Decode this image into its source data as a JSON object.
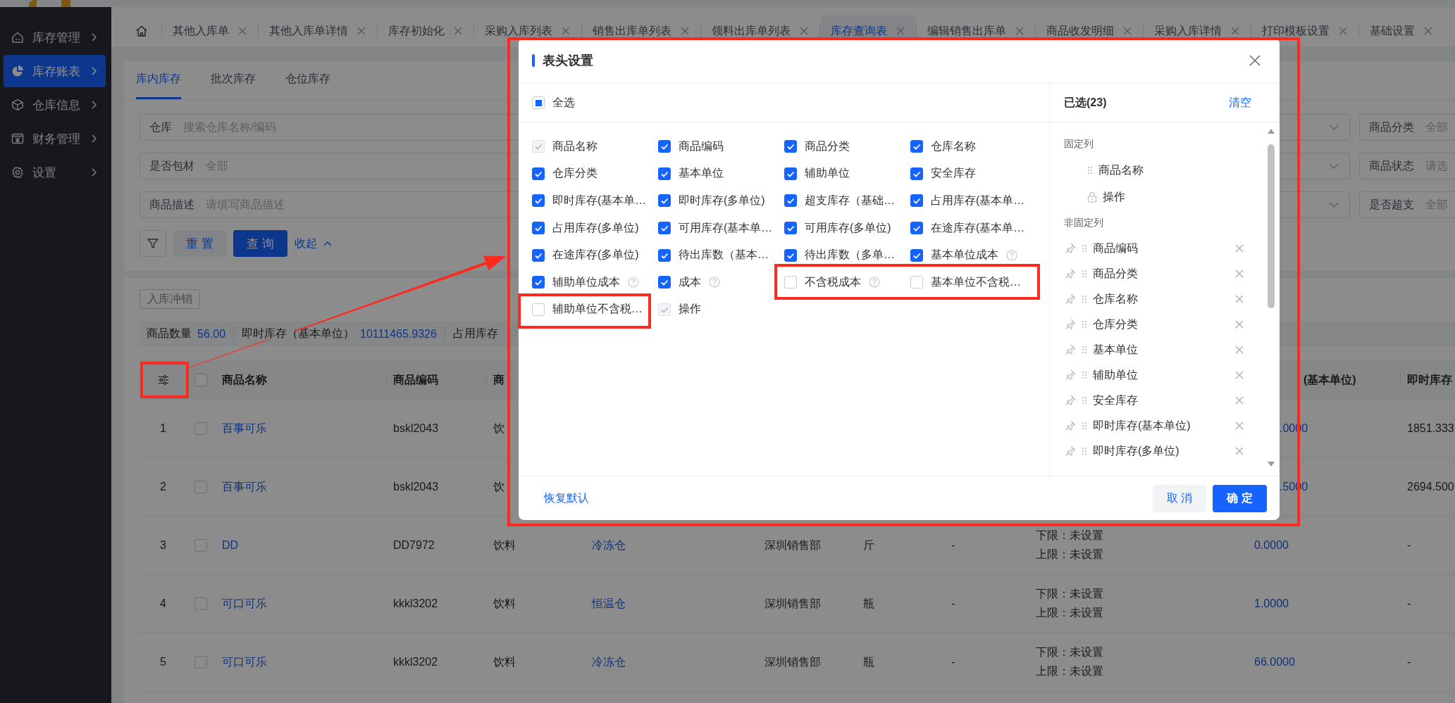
{
  "sidebar": {
    "items": [
      {
        "label": "库存管理",
        "selected": false
      },
      {
        "label": "库存账表",
        "selected": true
      },
      {
        "label": "仓库信息",
        "selected": false
      },
      {
        "label": "财务管理",
        "selected": false
      },
      {
        "label": "设置",
        "selected": false
      }
    ]
  },
  "tabs": [
    {
      "kind": "home",
      "selected": false
    },
    {
      "kind": "page",
      "label": "其他入库单",
      "selected": false
    },
    {
      "kind": "page",
      "label": "其他入库单详情",
      "selected": false
    },
    {
      "kind": "page",
      "label": "库存初始化",
      "selected": false
    },
    {
      "kind": "page",
      "label": "采购入库列表",
      "selected": false
    },
    {
      "kind": "page",
      "label": "销售出库单列表",
      "selected": false
    },
    {
      "kind": "page",
      "label": "领料出库单列表",
      "selected": false
    },
    {
      "kind": "page",
      "label": "库存查询表",
      "selected": true
    },
    {
      "kind": "page",
      "label": "编辑销售出库单",
      "selected": false
    },
    {
      "kind": "page",
      "label": "商品收发明细",
      "selected": false
    },
    {
      "kind": "page",
      "label": "采购入库详情",
      "selected": false
    },
    {
      "kind": "page",
      "label": "打印模板设置",
      "selected": false
    },
    {
      "kind": "page",
      "label": "基础设置",
      "selected": false
    }
  ],
  "sub_tabs": [
    {
      "label": "库内库存",
      "selected": true
    },
    {
      "label": "批次库存",
      "selected": false
    },
    {
      "label": "仓位库存",
      "selected": false
    }
  ],
  "filters": [
    {
      "label": "仓库",
      "placeholder": "搜索仓库名称/编码"
    },
    {
      "label": "商品分类",
      "placeholder": "全部"
    },
    {
      "label": "是否包材",
      "placeholder": "全部"
    },
    {
      "label": "商品状态",
      "placeholder": "请选"
    },
    {
      "label": "商品描述",
      "placeholder": "请填写商品描述"
    },
    {
      "label": "是否超支",
      "placeholder": "全部"
    }
  ],
  "filter_actions": {
    "reset": "重 置",
    "search": "查 询",
    "collapse": "收起"
  },
  "toolbar": [
    {
      "label": "入库冲销",
      "disabled": true
    }
  ],
  "summary": [
    {
      "label": "商品数量",
      "value": "56.00"
    },
    {
      "label": "即时库存（基本单位）",
      "value": "10111465.9326"
    },
    {
      "label": "占用库存"
    }
  ],
  "table": {
    "header_checkbox": {
      "checked": false
    },
    "columns": {
      "name": "商品名称",
      "code": "商品编码",
      "column_5": "商",
      "column_11": "(基本单位)",
      "column_12": "即时库存"
    },
    "rows": [
      {
        "index": "1",
        "selected": false,
        "name": "百事可乐",
        "code": "bskl2043",
        "column_5": "饮",
        "column_11": ".0000",
        "column_12": "1851.333"
      },
      {
        "index": "2",
        "selected": false,
        "name": "百事可乐",
        "code": "bskl2043",
        "column_5": "饮",
        "column_11": ".5000",
        "column_12": "2694.500"
      },
      {
        "index": "3",
        "selected": false,
        "name": "DD",
        "code": "DD7972",
        "column_5": "饮料",
        "column_6": "冷冻仓",
        "column_7": "深圳销售部",
        "column_8": "斤",
        "column_9": "-",
        "column_10": [
          "下限：未设置",
          "上限：未设置"
        ],
        "column_11": "0.0000",
        "column_12": "-"
      },
      {
        "index": "4",
        "selected": false,
        "name": "可口可乐",
        "code": "kkkl3202",
        "column_5": "饮料",
        "column_6": "恒温仓",
        "column_7": "深圳销售部",
        "column_8": "瓶",
        "column_9": "-",
        "column_10": [
          "下限：未设置",
          "上限：未设置"
        ],
        "column_11": "1.0000",
        "column_12": "-"
      },
      {
        "index": "5",
        "selected": false,
        "name": "可口可乐",
        "code": "kkkl3202",
        "column_5": "饮料",
        "column_6": "冷冻仓",
        "column_7": "深圳销售部",
        "column_8": "瓶",
        "column_9": "-",
        "column_10": [
          "下限：未设置",
          "上限：未设置"
        ],
        "column_11": "66.0000",
        "column_12": "-"
      }
    ]
  },
  "dialog": {
    "title": "表头设置",
    "select_all": {
      "label": "全选",
      "indeterminate": true
    },
    "options": [
      {
        "label": "商品名称",
        "checked": true,
        "disabled": true,
        "help": false
      },
      {
        "label": "商品编码",
        "checked": true,
        "disabled": false,
        "help": false
      },
      {
        "label": "商品分类",
        "checked": true,
        "disabled": false,
        "help": false
      },
      {
        "label": "仓库名称",
        "checked": true,
        "disabled": false,
        "help": false
      },
      {
        "label": "仓库分类",
        "checked": true,
        "disabled": false,
        "help": false
      },
      {
        "label": "基本单位",
        "checked": true,
        "disabled": false,
        "help": false
      },
      {
        "label": "辅助单位",
        "checked": true,
        "disabled": false,
        "help": false
      },
      {
        "label": "安全库存",
        "checked": true,
        "disabled": false,
        "help": false
      },
      {
        "label": "即时库存(基本单…",
        "checked": true,
        "disabled": false,
        "help": false
      },
      {
        "label": "即时库存(多单位)",
        "checked": true,
        "disabled": false,
        "help": false
      },
      {
        "label": "超支库存（基础…",
        "checked": true,
        "disabled": false,
        "help": false
      },
      {
        "label": "占用库存(基本单…",
        "checked": true,
        "disabled": false,
        "help": false
      },
      {
        "label": "占用库存(多单位)",
        "checked": true,
        "disabled": false,
        "help": false
      },
      {
        "label": "可用库存(基本单…",
        "checked": true,
        "disabled": false,
        "help": false
      },
      {
        "label": "可用库存(多单位)",
        "checked": true,
        "disabled": false,
        "help": false
      },
      {
        "label": "在途库存(基本单…",
        "checked": true,
        "disabled": false,
        "help": false
      },
      {
        "label": "在途库存(多单位)",
        "checked": true,
        "disabled": false,
        "help": false
      },
      {
        "label": "待出库数（基本…",
        "checked": true,
        "disabled": false,
        "help": false
      },
      {
        "label": "待出库数（多单…",
        "checked": true,
        "disabled": false,
        "help": false
      },
      {
        "label": "基本单位成本",
        "checked": true,
        "disabled": false,
        "help": true
      },
      {
        "label": "辅助单位成本",
        "checked": true,
        "disabled": false,
        "help": true
      },
      {
        "label": "成本",
        "checked": true,
        "disabled": false,
        "help": true
      },
      {
        "label": "不含税成本",
        "checked": false,
        "disabled": false,
        "help": true
      },
      {
        "label": "基本单位不含税…",
        "checked": false,
        "disabled": false,
        "help": false
      },
      {
        "label": "辅助单位不含税…",
        "checked": false,
        "disabled": false,
        "help": false
      },
      {
        "label": "操作",
        "checked": true,
        "disabled": true,
        "help": false
      }
    ],
    "selected_panel": {
      "title": "已选(23)",
      "clear": "清空",
      "groups": [
        {
          "label": "固定列",
          "kind": "fixed",
          "items": [
            {
              "label": "商品名称",
              "locked": false
            },
            {
              "label": "操作",
              "locked": true
            }
          ]
        },
        {
          "label": "非固定列",
          "kind": "movable",
          "items": [
            {
              "label": "商品编码"
            },
            {
              "label": "商品分类"
            },
            {
              "label": "仓库名称"
            },
            {
              "label": "仓库分类"
            },
            {
              "label": "基本单位"
            },
            {
              "label": "辅助单位"
            },
            {
              "label": "安全库存"
            },
            {
              "label": "即时库存(基本单位)"
            },
            {
              "label": "即时库存(多单位)"
            }
          ]
        }
      ]
    },
    "footer": {
      "reset": "恢复默认",
      "cancel": "取 消",
      "confirm": "确 定"
    }
  }
}
